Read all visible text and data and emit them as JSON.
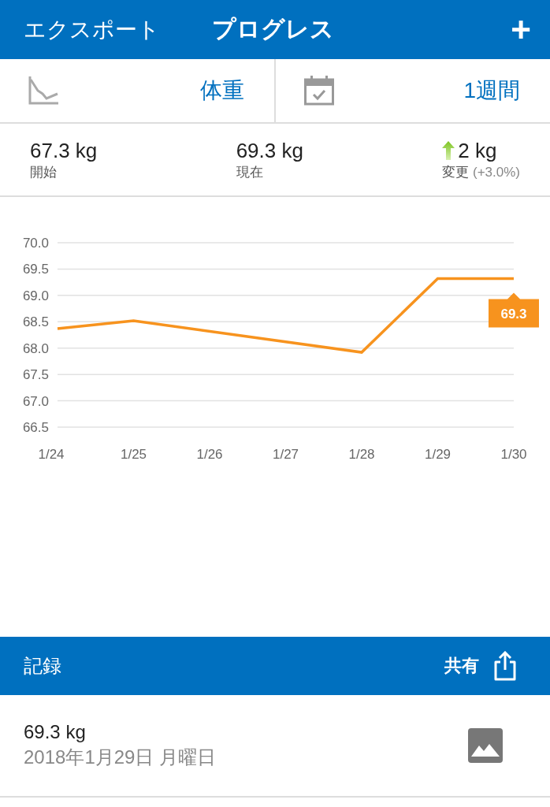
{
  "header": {
    "left_button": "エクスポート",
    "title": "プログレス",
    "add_button": "+"
  },
  "selectors": [
    {
      "kind": "metric",
      "label": "体重"
    },
    {
      "kind": "period",
      "label": "1週間"
    }
  ],
  "stats": [
    {
      "kind": "plain",
      "value": "67.3 kg",
      "label": "開始"
    },
    {
      "kind": "plain",
      "value": "69.3 kg",
      "label": "現在"
    },
    {
      "kind": "change",
      "value": "2 kg",
      "label": "変更",
      "note": "(+3.0%)"
    }
  ],
  "chart": {
    "chart_data": {
      "type": "line",
      "categories": [
        "1/24",
        "1/25",
        "1/26",
        "1/27",
        "1/28",
        "1/29",
        "1/30"
      ],
      "grid": true,
      "series": [
        {
          "color": "#f7931e",
          "values": [
            68.37,
            68.52,
            null,
            null,
            67.92,
            69.32,
            69.32
          ]
        }
      ],
      "ylim": [
        66.5,
        70.0
      ],
      "yticks": [
        {
          "value": 66.5,
          "label": "66.5"
        },
        {
          "value": 67,
          "label": "67.0"
        },
        {
          "value": 67.5,
          "label": "67.5"
        },
        {
          "value": 68,
          "label": "68.0"
        },
        {
          "value": 68.5,
          "label": "68.5"
        },
        {
          "value": 69,
          "label": "69.0"
        },
        {
          "value": 69.5,
          "label": "69.5"
        },
        {
          "value": 70,
          "label": "70.0"
        }
      ],
      "annotations": [
        {
          "x": "1/30",
          "y": 69.32,
          "text": "69.3"
        }
      ]
    }
  },
  "records_bar": {
    "title": "記録",
    "share_button": "共有"
  },
  "records": [
    {
      "value": "69.3 kg",
      "date": "2018年1月29日 月曜日"
    }
  ]
}
